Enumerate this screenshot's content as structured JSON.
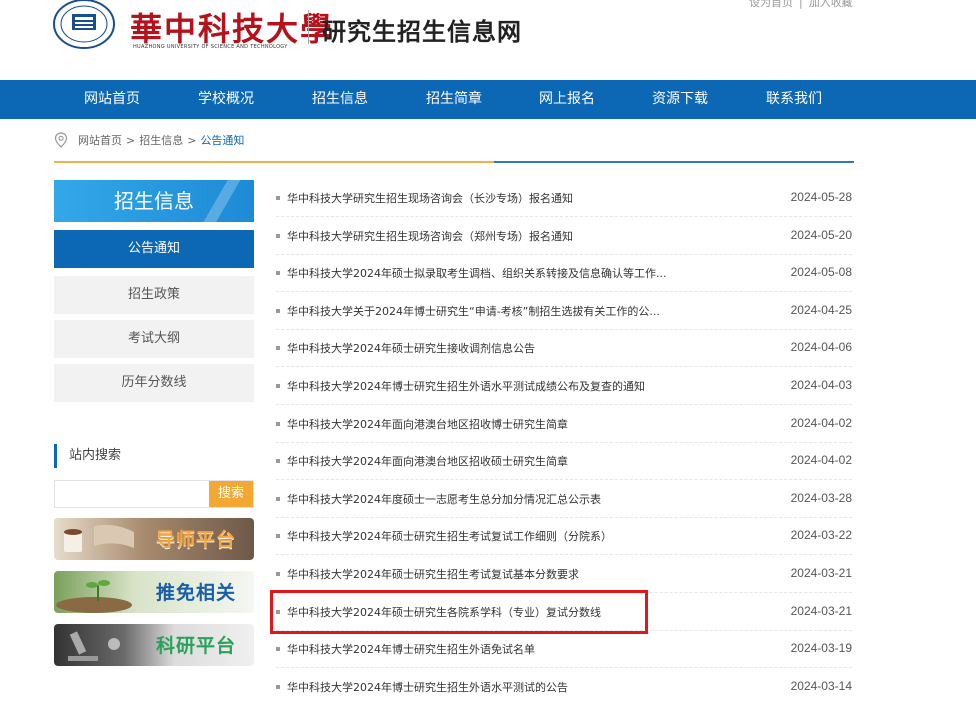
{
  "header": {
    "logo_cn": "華中科技大學",
    "logo_en": "HUAZHONG UNIVERSITY OF SCIENCE AND TECHNOLOGY",
    "site_title": "研究生招生信息网",
    "set_home": "设为首页",
    "separator": "|",
    "add_favorite": "加入收藏"
  },
  "nav": {
    "items": [
      "网站首页",
      "学校概况",
      "招生信息",
      "招生简章",
      "网上报名",
      "资源下载",
      "联系我们"
    ]
  },
  "breadcrumb": {
    "home": "网站首页",
    "gt": ">",
    "section": "招生信息",
    "current": "公告通知"
  },
  "sidebar": {
    "title": "招生信息",
    "items": [
      {
        "label": "公告通知",
        "active": true
      },
      {
        "label": "招生政策",
        "active": false
      },
      {
        "label": "考试大纲",
        "active": false
      },
      {
        "label": "历年分数线",
        "active": false
      }
    ],
    "search_label": "站内搜索",
    "search_placeholder": "",
    "search_button": "搜索",
    "banners": [
      "导师平台",
      "推免相关",
      "科研平台"
    ]
  },
  "news": [
    {
      "title": "华中科技大学研究生招生现场咨询会（长沙专场）报名通知",
      "date": "2024-05-28"
    },
    {
      "title": "华中科技大学研究生招生现场咨询会（郑州专场）报名通知",
      "date": "2024-05-20"
    },
    {
      "title": "华中科技大学2024年硕士拟录取考生调档、组织关系转接及信息确认等工作...",
      "date": "2024-05-08"
    },
    {
      "title": "华中科技大学关于2024年博士研究生“申请-考核”制招生选拔有关工作的公...",
      "date": "2024-04-25"
    },
    {
      "title": "华中科技大学2024年硕士研究生接收调剂信息公告",
      "date": "2024-04-06"
    },
    {
      "title": "华中科技大学2024年博士研究生招生外语水平测试成绩公布及复查的通知",
      "date": "2024-04-03"
    },
    {
      "title": "华中科技大学2024年面向港澳台地区招收博士研究生简章",
      "date": "2024-04-02"
    },
    {
      "title": "华中科技大学2024年面向港澳台地区招收硕士研究生简章",
      "date": "2024-04-02"
    },
    {
      "title": "华中科技大学2024年度硕士一志愿考生总分加分情况汇总公示表",
      "date": "2024-03-28"
    },
    {
      "title": "华中科技大学2024年硕士研究生招生考试复试工作细则（分院系）",
      "date": "2024-03-22"
    },
    {
      "title": "华中科技大学2024年硕士研究生招生考试复试基本分数要求",
      "date": "2024-03-21"
    },
    {
      "title": "华中科技大学2024年硕士研究生各院系学科（专业）复试分数线",
      "date": "2024-03-21"
    },
    {
      "title": "华中科技大学2024年博士研究生招生外语免试名单",
      "date": "2024-03-19"
    },
    {
      "title": "华中科技大学2024年博士研究生招生外语水平测试的公告",
      "date": "2024-03-14"
    }
  ],
  "colors": {
    "nav_blue": "#0c67b4",
    "accent_orange": "#f3a833",
    "highlight_red": "#e0181d",
    "logo_red": "#b5121b"
  }
}
